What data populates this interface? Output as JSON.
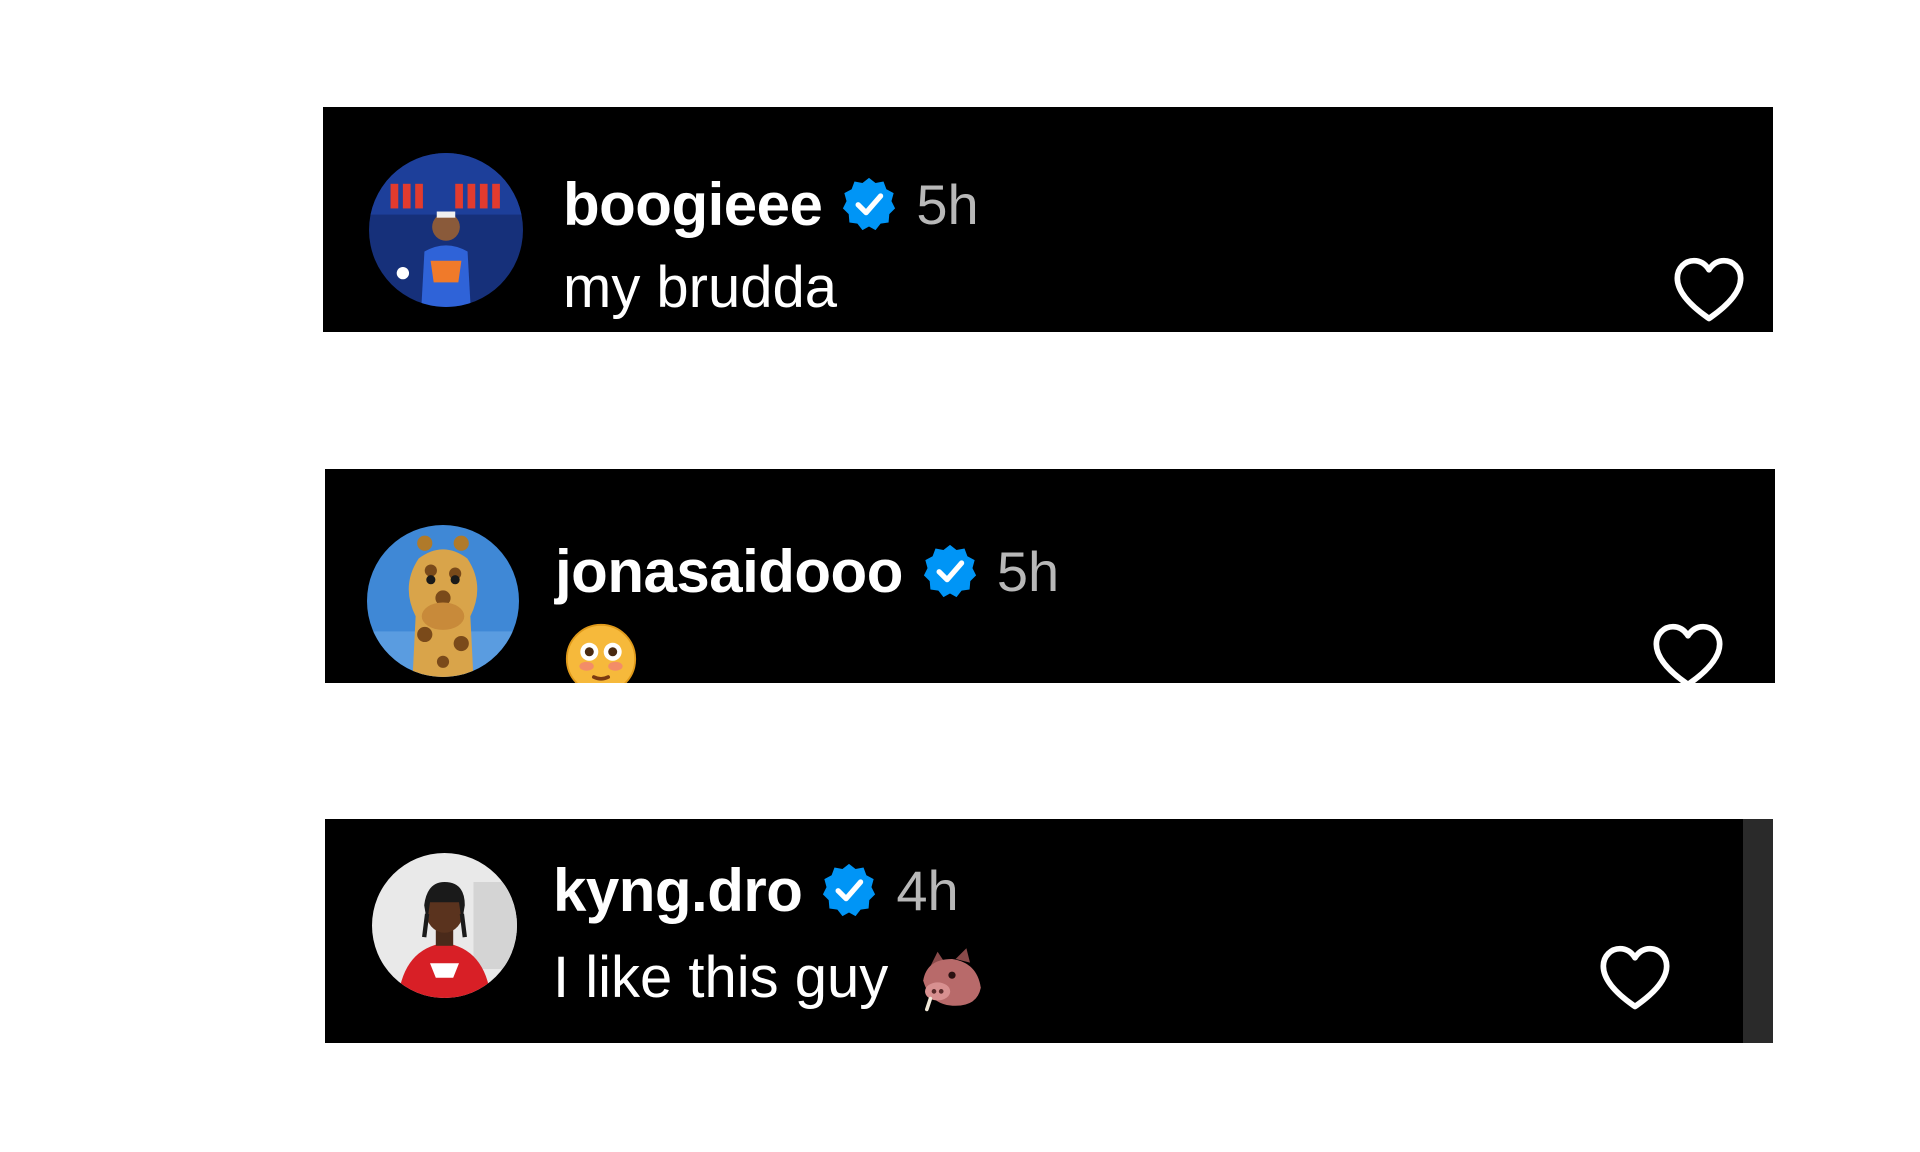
{
  "comments": [
    {
      "username": "boogieee",
      "time": "5h",
      "text": "my brudda",
      "verified": true,
      "avatar_icon": "avatar-basketball-player",
      "like_icon": "heart-outline"
    },
    {
      "username": "jonasaidooo",
      "time": "5h",
      "text": "",
      "verified": true,
      "avatar_icon": "avatar-giraffe",
      "emoji": "flushed-face",
      "like_icon": "heart-outline"
    },
    {
      "username": "kyng.dro",
      "time": "4h",
      "text": "I like this guy",
      "verified": true,
      "avatar_icon": "avatar-man-red-shirt",
      "emoji": "boar-face",
      "like_icon": "heart-outline"
    }
  ],
  "colors": {
    "background": "#000000",
    "username": "#ffffff",
    "time": "#b8b8b8",
    "verified_badge": "#0095f6",
    "heart_outline": "#ffffff"
  }
}
